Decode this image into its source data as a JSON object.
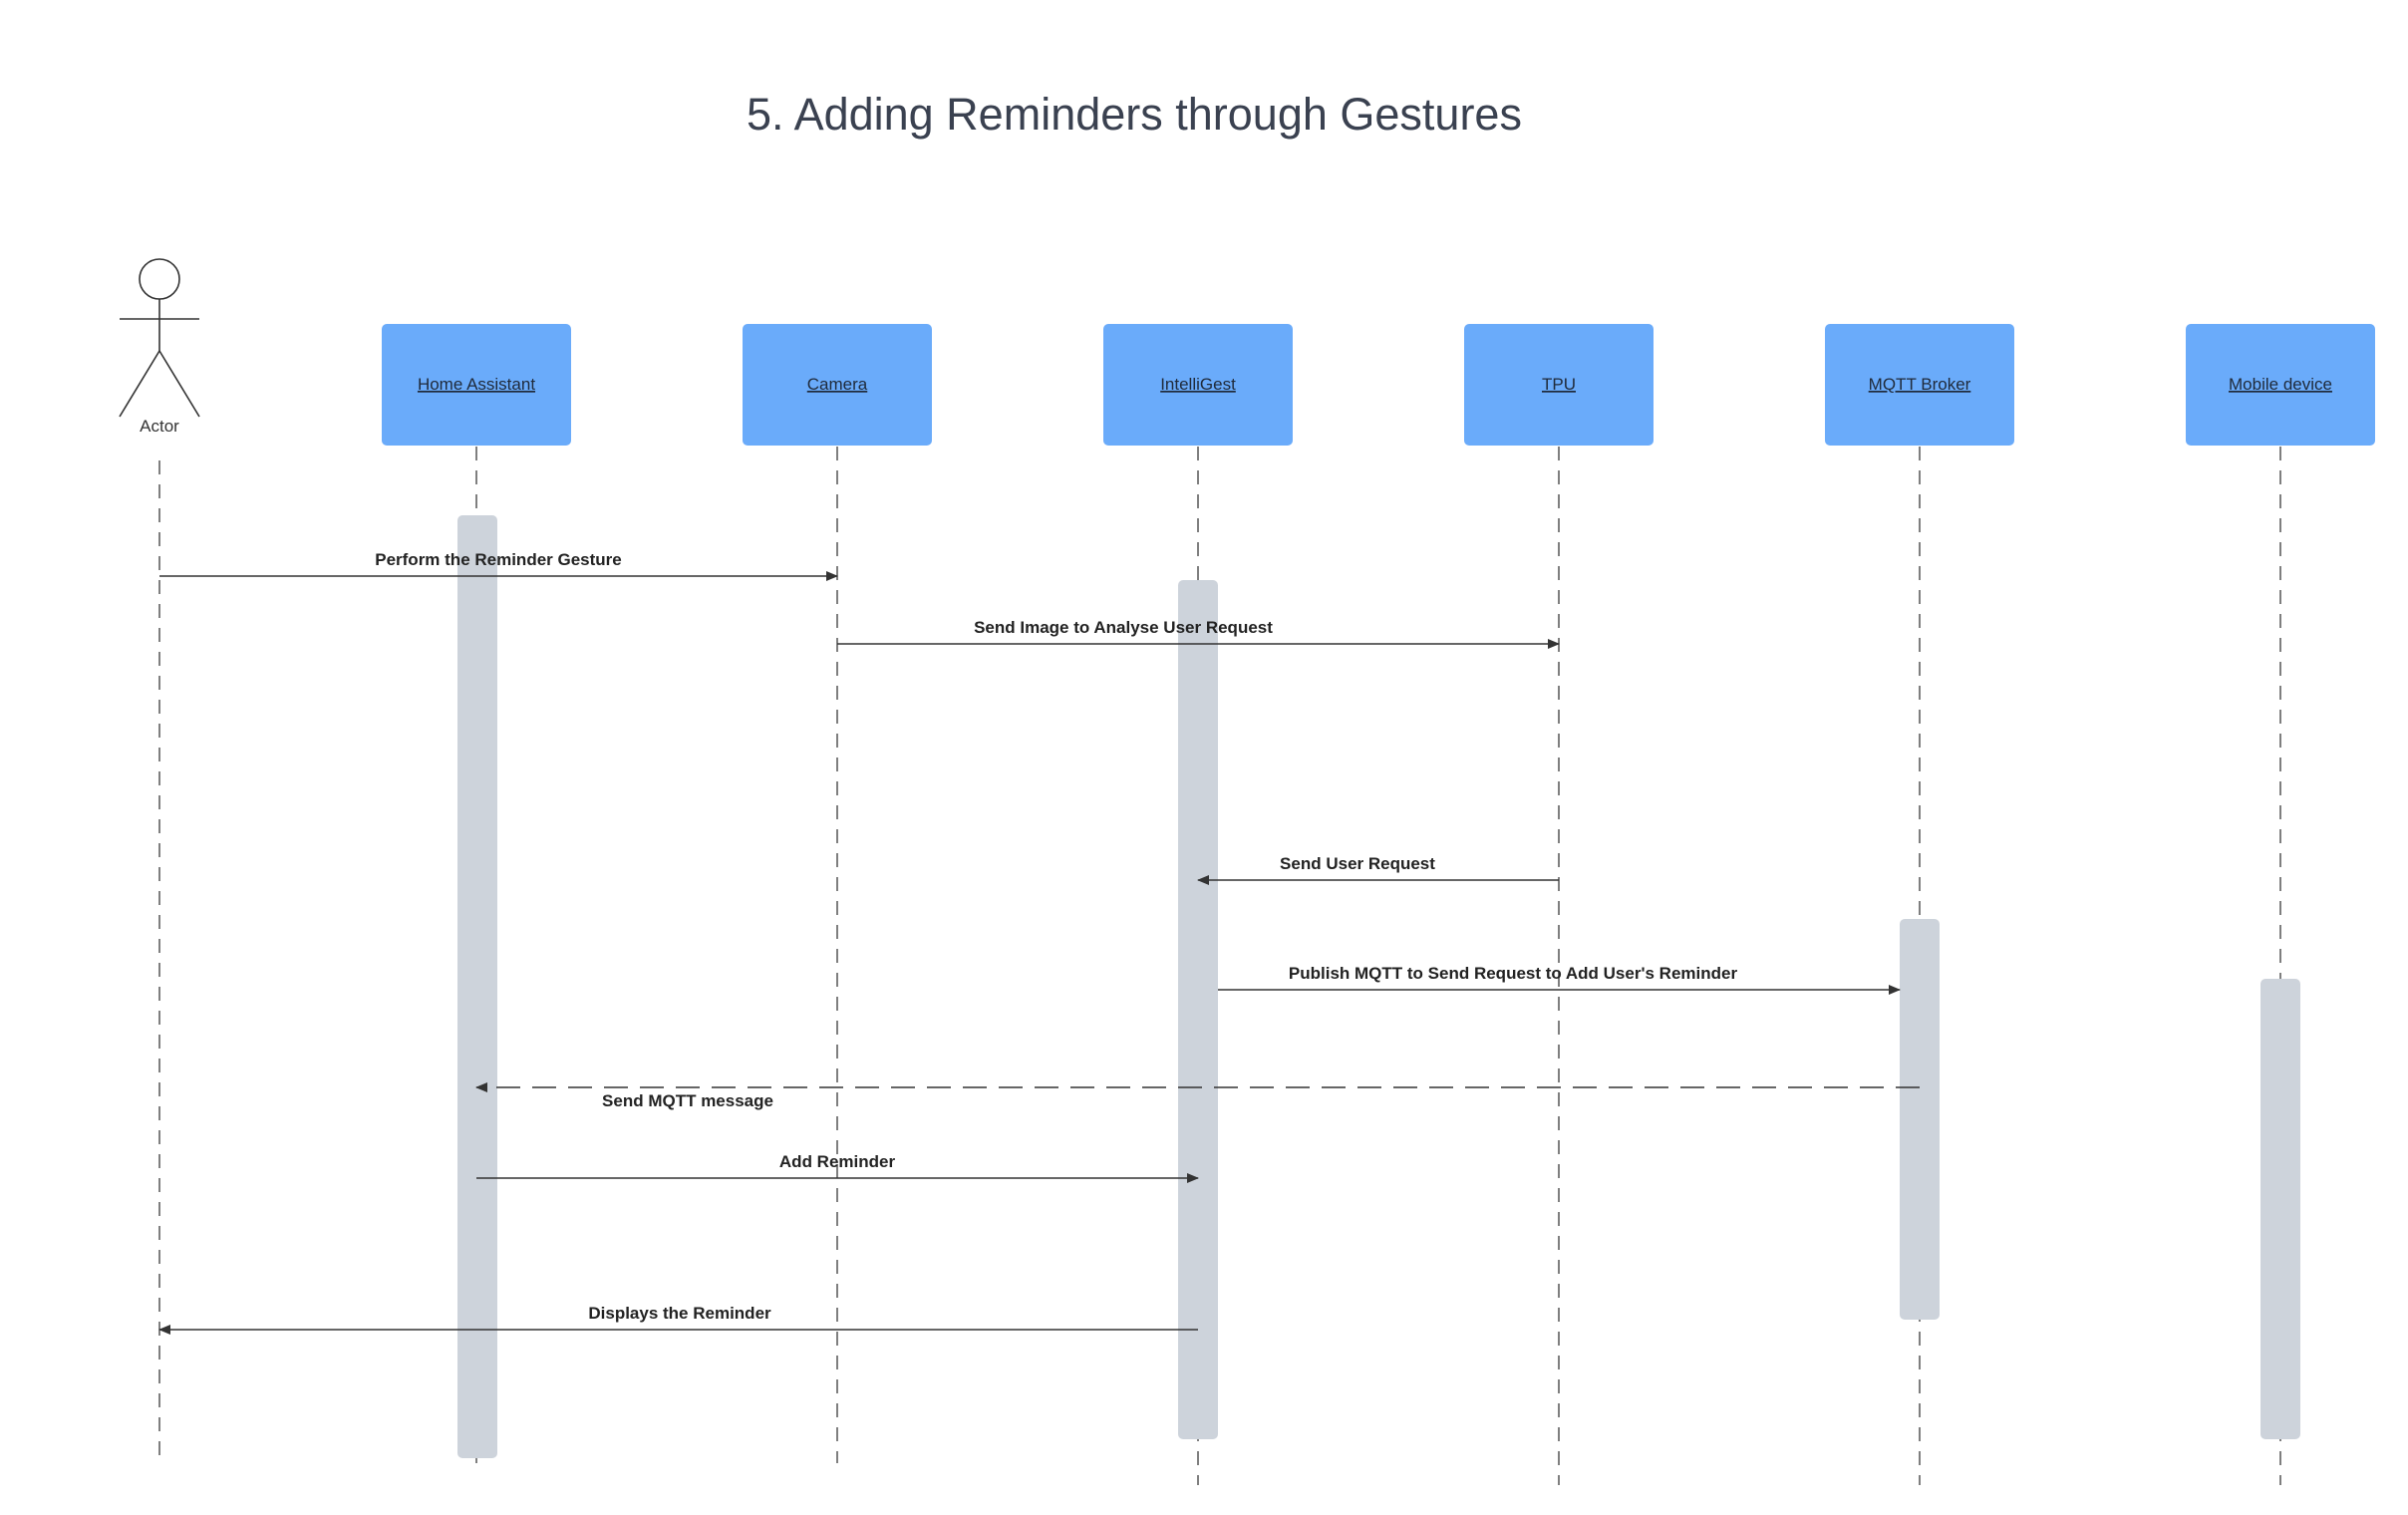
{
  "title": "5. Adding Reminders through Gestures",
  "actor": {
    "label": "Actor"
  },
  "participants": [
    {
      "id": "home-assistant",
      "label": "Home Assistant"
    },
    {
      "id": "camera",
      "label": "Camera"
    },
    {
      "id": "intelligest",
      "label": "IntelliGest"
    },
    {
      "id": "tpu",
      "label": "TPU"
    },
    {
      "id": "mqtt-broker",
      "label": "MQTT Broker"
    },
    {
      "id": "mobile-device",
      "label": "Mobile device"
    }
  ],
  "messages": [
    {
      "from": "actor",
      "to": "camera",
      "label": "Perform the Reminder Gesture",
      "style": "solid"
    },
    {
      "from": "camera",
      "to": "tpu",
      "label": "Send Image to Analyse User Request",
      "style": "solid"
    },
    {
      "from": "tpu",
      "to": "intelligest",
      "label": "Send User Request",
      "style": "solid"
    },
    {
      "from": "intelligest",
      "to": "mqtt-broker",
      "label": "Publish MQTT to Send Request to Add User's Reminder",
      "style": "solid"
    },
    {
      "from": "mqtt-broker",
      "to": "home-assistant",
      "label": "Send MQTT message",
      "style": "dashed"
    },
    {
      "from": "home-assistant",
      "to": "intelligest",
      "label": "Add Reminder",
      "style": "solid"
    },
    {
      "from": "intelligest",
      "to": "actor",
      "label": "Displays the Reminder",
      "style": "solid"
    }
  ],
  "colors": {
    "participant_box": "#6aabfa",
    "activation_bar": "#cdd3db",
    "title": "#3a4150",
    "line": "#333333"
  }
}
